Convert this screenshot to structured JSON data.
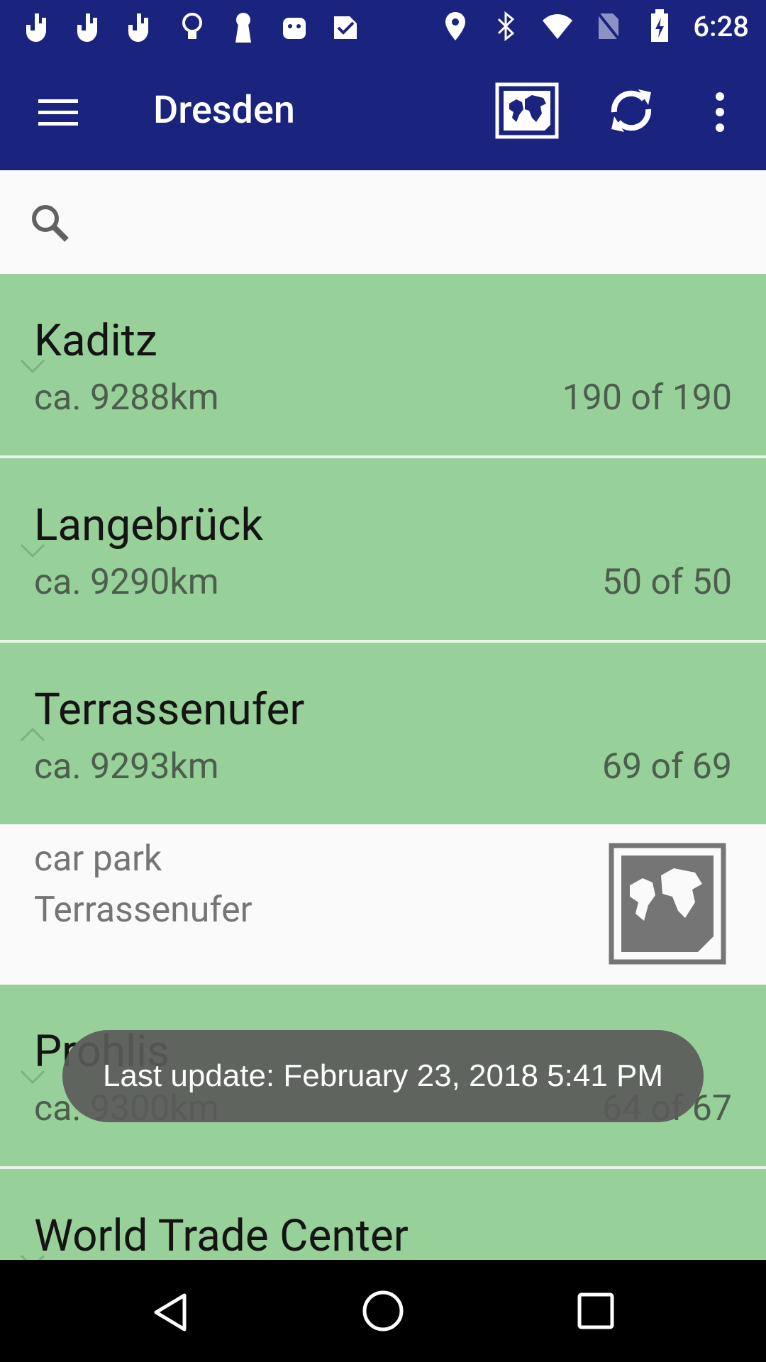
{
  "status_bar": {
    "time": "6:28",
    "left_icons": [
      "hand-icon",
      "hand-icon",
      "hand-icon",
      "lightbulb-icon",
      "keyhole-icon",
      "android-icon",
      "check-icon"
    ],
    "right_icons": [
      "location-icon",
      "bluetooth-icon",
      "wifi-icon",
      "no-sim-icon",
      "battery-icon"
    ]
  },
  "app_bar": {
    "title": "Dresden",
    "actions": [
      "map-icon",
      "refresh-icon",
      "more-vert-icon"
    ]
  },
  "search": {
    "placeholder": ""
  },
  "groups": [
    {
      "name": "Kaditz",
      "distance": "ca. 9288km",
      "count": "190 of 190",
      "expanded": false
    },
    {
      "name": "Langebrück",
      "distance": "ca. 9290km",
      "count": "50 of 50",
      "expanded": false
    },
    {
      "name": "Terrassenufer",
      "distance": "ca. 9293km",
      "count": "69 of 69",
      "expanded": true,
      "children": [
        {
          "type": "car park",
          "name": "Terrassenufer"
        }
      ]
    },
    {
      "name": "Prohlis",
      "distance": "ca. 9300km",
      "count": "64 of 67",
      "expanded": false
    },
    {
      "name": "World Trade Center",
      "distance": "",
      "count": "",
      "expanded": false
    }
  ],
  "toast": {
    "text": "Last update: February 23, 2018 5:41 PM"
  },
  "colors": {
    "primary": "#1a237e",
    "group_bg": "#98d099",
    "child_bg": "#fafafa"
  }
}
